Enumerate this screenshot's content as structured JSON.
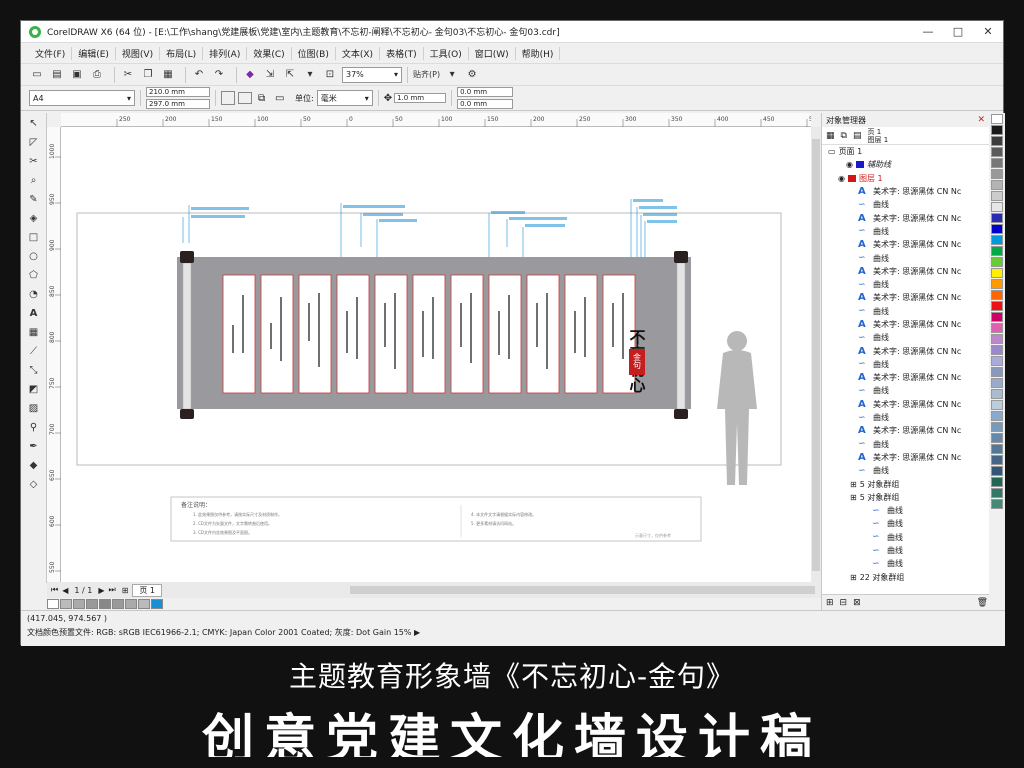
{
  "window": {
    "title": "CorelDRAW X6 (64 位) - [E:\\工作\\shang\\党建展板\\党建\\室内\\主题教育\\不忘初-阐释\\不忘初心- 金句03\\不忘初心- 金句03.cdr]",
    "minimize": "—",
    "maximize": "□",
    "close": "✕"
  },
  "menu": [
    "文件(F)",
    "编辑(E)",
    "视图(V)",
    "布局(L)",
    "排列(A)",
    "效果(C)",
    "位图(B)",
    "文本(X)",
    "表格(T)",
    "工具(O)",
    "窗口(W)",
    "帮助(H)"
  ],
  "toolbar": {
    "zoom": "37%",
    "snap": "贴齐(P)"
  },
  "propbar": {
    "page_size": "A4",
    "width": "210.0 mm",
    "height": "297.0 mm",
    "units_label": "单位:",
    "units": "毫米",
    "nudge": "1.0 mm",
    "dup_x": "0.0 mm",
    "dup_y": "0.0 mm"
  },
  "ruler": {
    "h_ticks": [
      "250",
      "200",
      "150",
      "100",
      "50",
      "0",
      "50",
      "100",
      "150",
      "200",
      "250",
      "300",
      "350",
      "400",
      "450",
      "500"
    ],
    "v_ticks": [
      "1000",
      "950",
      "900",
      "850",
      "800",
      "750",
      "700",
      "650",
      "600",
      "550"
    ]
  },
  "canvas": {
    "notes_title": "备注说明：",
    "notes": [
      "1. 此效果图仅供参考，请按实际尺寸及材质制作。",
      "2. CD文件为矢量文件，文字需转曲后使用。",
      "3. CD文件内含效果图及平面图。",
      "4. 本文件文字请根据实际内容修改。",
      "5. 更多素材请访问网站。"
    ],
    "notes_footer": "示意尺寸，仅供参考",
    "scroll_title": "不忘初心",
    "scroll_seal": "金句"
  },
  "page_nav": {
    "pages": "1 / 1",
    "page_tab": "页 1"
  },
  "object_manager": {
    "title": "对象管理器",
    "page_label": "页 1",
    "layer_label": "图层 1",
    "rows": [
      {
        "kind": "page",
        "text": "页面 1"
      },
      {
        "kind": "layer-guide",
        "text": "辅助线"
      },
      {
        "kind": "layer",
        "text": "图层 1"
      },
      {
        "kind": "text",
        "text": "美术字: 思源黑体 CN Nc"
      },
      {
        "kind": "curve",
        "text": "曲线"
      },
      {
        "kind": "text",
        "text": "美术字: 思源黑体 CN Nc"
      },
      {
        "kind": "curve",
        "text": "曲线"
      },
      {
        "kind": "text",
        "text": "美术字: 思源黑体 CN Nc"
      },
      {
        "kind": "curve",
        "text": "曲线"
      },
      {
        "kind": "text",
        "text": "美术字: 思源黑体 CN Nc"
      },
      {
        "kind": "curve",
        "text": "曲线"
      },
      {
        "kind": "text",
        "text": "美术字: 思源黑体 CN Nc"
      },
      {
        "kind": "curve",
        "text": "曲线"
      },
      {
        "kind": "text",
        "text": "美术字: 思源黑体 CN Nc"
      },
      {
        "kind": "curve",
        "text": "曲线"
      },
      {
        "kind": "text",
        "text": "美术字: 思源黑体 CN Nc"
      },
      {
        "kind": "curve",
        "text": "曲线"
      },
      {
        "kind": "text",
        "text": "美术字: 思源黑体 CN Nc"
      },
      {
        "kind": "curve",
        "text": "曲线"
      },
      {
        "kind": "text",
        "text": "美术字: 思源黑体 CN Nc"
      },
      {
        "kind": "curve",
        "text": "曲线"
      },
      {
        "kind": "text",
        "text": "美术字: 思源黑体 CN Nc"
      },
      {
        "kind": "curve",
        "text": "曲线"
      },
      {
        "kind": "text",
        "text": "美术字: 思源黑体 CN Nc"
      },
      {
        "kind": "curve",
        "text": "曲线"
      },
      {
        "kind": "group",
        "text": "5 对象群组"
      },
      {
        "kind": "group",
        "text": "5 对象群组"
      },
      {
        "kind": "curve2",
        "text": "曲线"
      },
      {
        "kind": "curve2",
        "text": "曲线"
      },
      {
        "kind": "curve2",
        "text": "曲线"
      },
      {
        "kind": "curve2",
        "text": "曲线"
      },
      {
        "kind": "curve2",
        "text": "曲线"
      },
      {
        "kind": "group",
        "text": "22 对象群组"
      }
    ]
  },
  "status": {
    "coords": "(417.045, 974.567 )",
    "profile": "文档颜色预置文件: RGB: sRGB IEC61966-2.1; CMYK: Japan Color 2001 Coated; 灰度: Dot Gain 15% ▶"
  },
  "captions": {
    "line1": "主题教育形象墙《不忘初心-金句》",
    "line2": "创意党建文化墙设计稿"
  },
  "colors": {
    "accent_blue": "#1a8fd6",
    "palette": [
      "#ffffff",
      "#1a1a1a",
      "#3d3d3d",
      "#5a5a5a",
      "#777777",
      "#999999",
      "#b3b3b3",
      "#cccccc",
      "#e6e6e6",
      "#2b2bb0",
      "#0000cc",
      "#0099dd",
      "#00aa44",
      "#66cc33",
      "#ffee00",
      "#ff9900",
      "#ff6600",
      "#ee1111",
      "#cc0066",
      "#e060b0",
      "#bb88cc",
      "#9988cc",
      "#aaaadd",
      "#8899bb",
      "#99aacc",
      "#aabbcc",
      "#bbccdd",
      "#88aacc",
      "#7799bb",
      "#6688aa",
      "#557799",
      "#446688",
      "#335577",
      "#226655",
      "#337766",
      "#448877"
    ]
  }
}
